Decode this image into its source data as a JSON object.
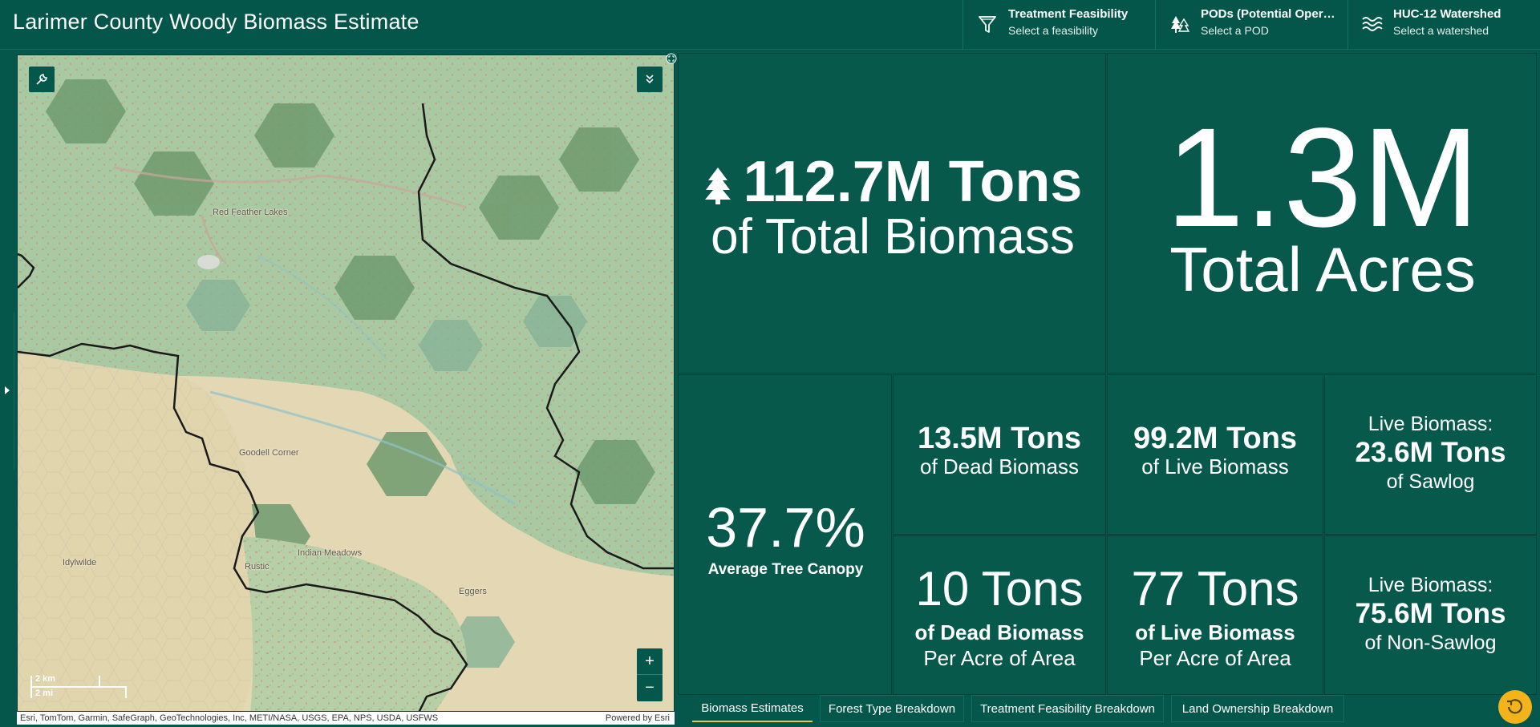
{
  "header": {
    "title": "Larimer County Woody Biomass Estimate",
    "selectors": [
      {
        "title": "Treatment Feasibility",
        "subtitle": "Select a feasibility",
        "icon": "funnel-icon"
      },
      {
        "title": "PODs (Potential Operat...",
        "subtitle": "Select a POD",
        "icon": "fire-trees-icon"
      },
      {
        "title": "HUC-12 Watershed",
        "subtitle": "Select a watershed",
        "icon": "water-waves-icon"
      }
    ]
  },
  "map": {
    "places": [
      "Red Feather Lakes",
      "Goodell Corner",
      "Indian Meadows",
      "Idylwilde",
      "Rustic",
      "Eggers"
    ],
    "scale": {
      "km": "2 km",
      "mi": "2 mi"
    },
    "attribution": "Esri, TomTom, Garmin, SafeGraph, GeoTechnologies, Inc, METI/NASA, USGS, EPA, NPS, USDA, USFWS",
    "powered_by": "Powered by Esri",
    "zoom_in": "+",
    "zoom_out": "−"
  },
  "kpis": {
    "total_biomass": {
      "value": "112.7M Tons",
      "label": "of Total Biomass"
    },
    "total_acres": {
      "value": "1.3M",
      "label": "Total Acres"
    },
    "canopy": {
      "value": "37.7%",
      "label": "Average Tree Canopy"
    },
    "dead": {
      "value": "13.5M Tons",
      "label": "of Dead Biomass"
    },
    "live": {
      "value": "99.2M Tons",
      "label": "of Live Biomass"
    },
    "sawlog": {
      "pre": "Live Biomass:",
      "value": "23.6M Tons",
      "label": "of Sawlog"
    },
    "dead_per_acre": {
      "value": "10 Tons",
      "label1": "of Dead Biomass",
      "label2": "Per Acre of Area"
    },
    "live_per_acre": {
      "value": "77 Tons",
      "label1": "of Live Biomass",
      "label2": "Per Acre of Area"
    },
    "nonsawlog": {
      "pre": "Live Biomass:",
      "value": "75.6M Tons",
      "label": "of Non-Sawlog"
    }
  },
  "tabs": [
    {
      "label": "Biomass Estimates",
      "active": true
    },
    {
      "label": "Forest Type Breakdown",
      "active": false
    },
    {
      "label": "Treatment Feasibility Breakdown",
      "active": false
    },
    {
      "label": "Land Ownership Breakdown",
      "active": false
    }
  ],
  "colors": {
    "background": "#06574b",
    "accent": "#e8c547",
    "refresh": "#f2b31b"
  }
}
